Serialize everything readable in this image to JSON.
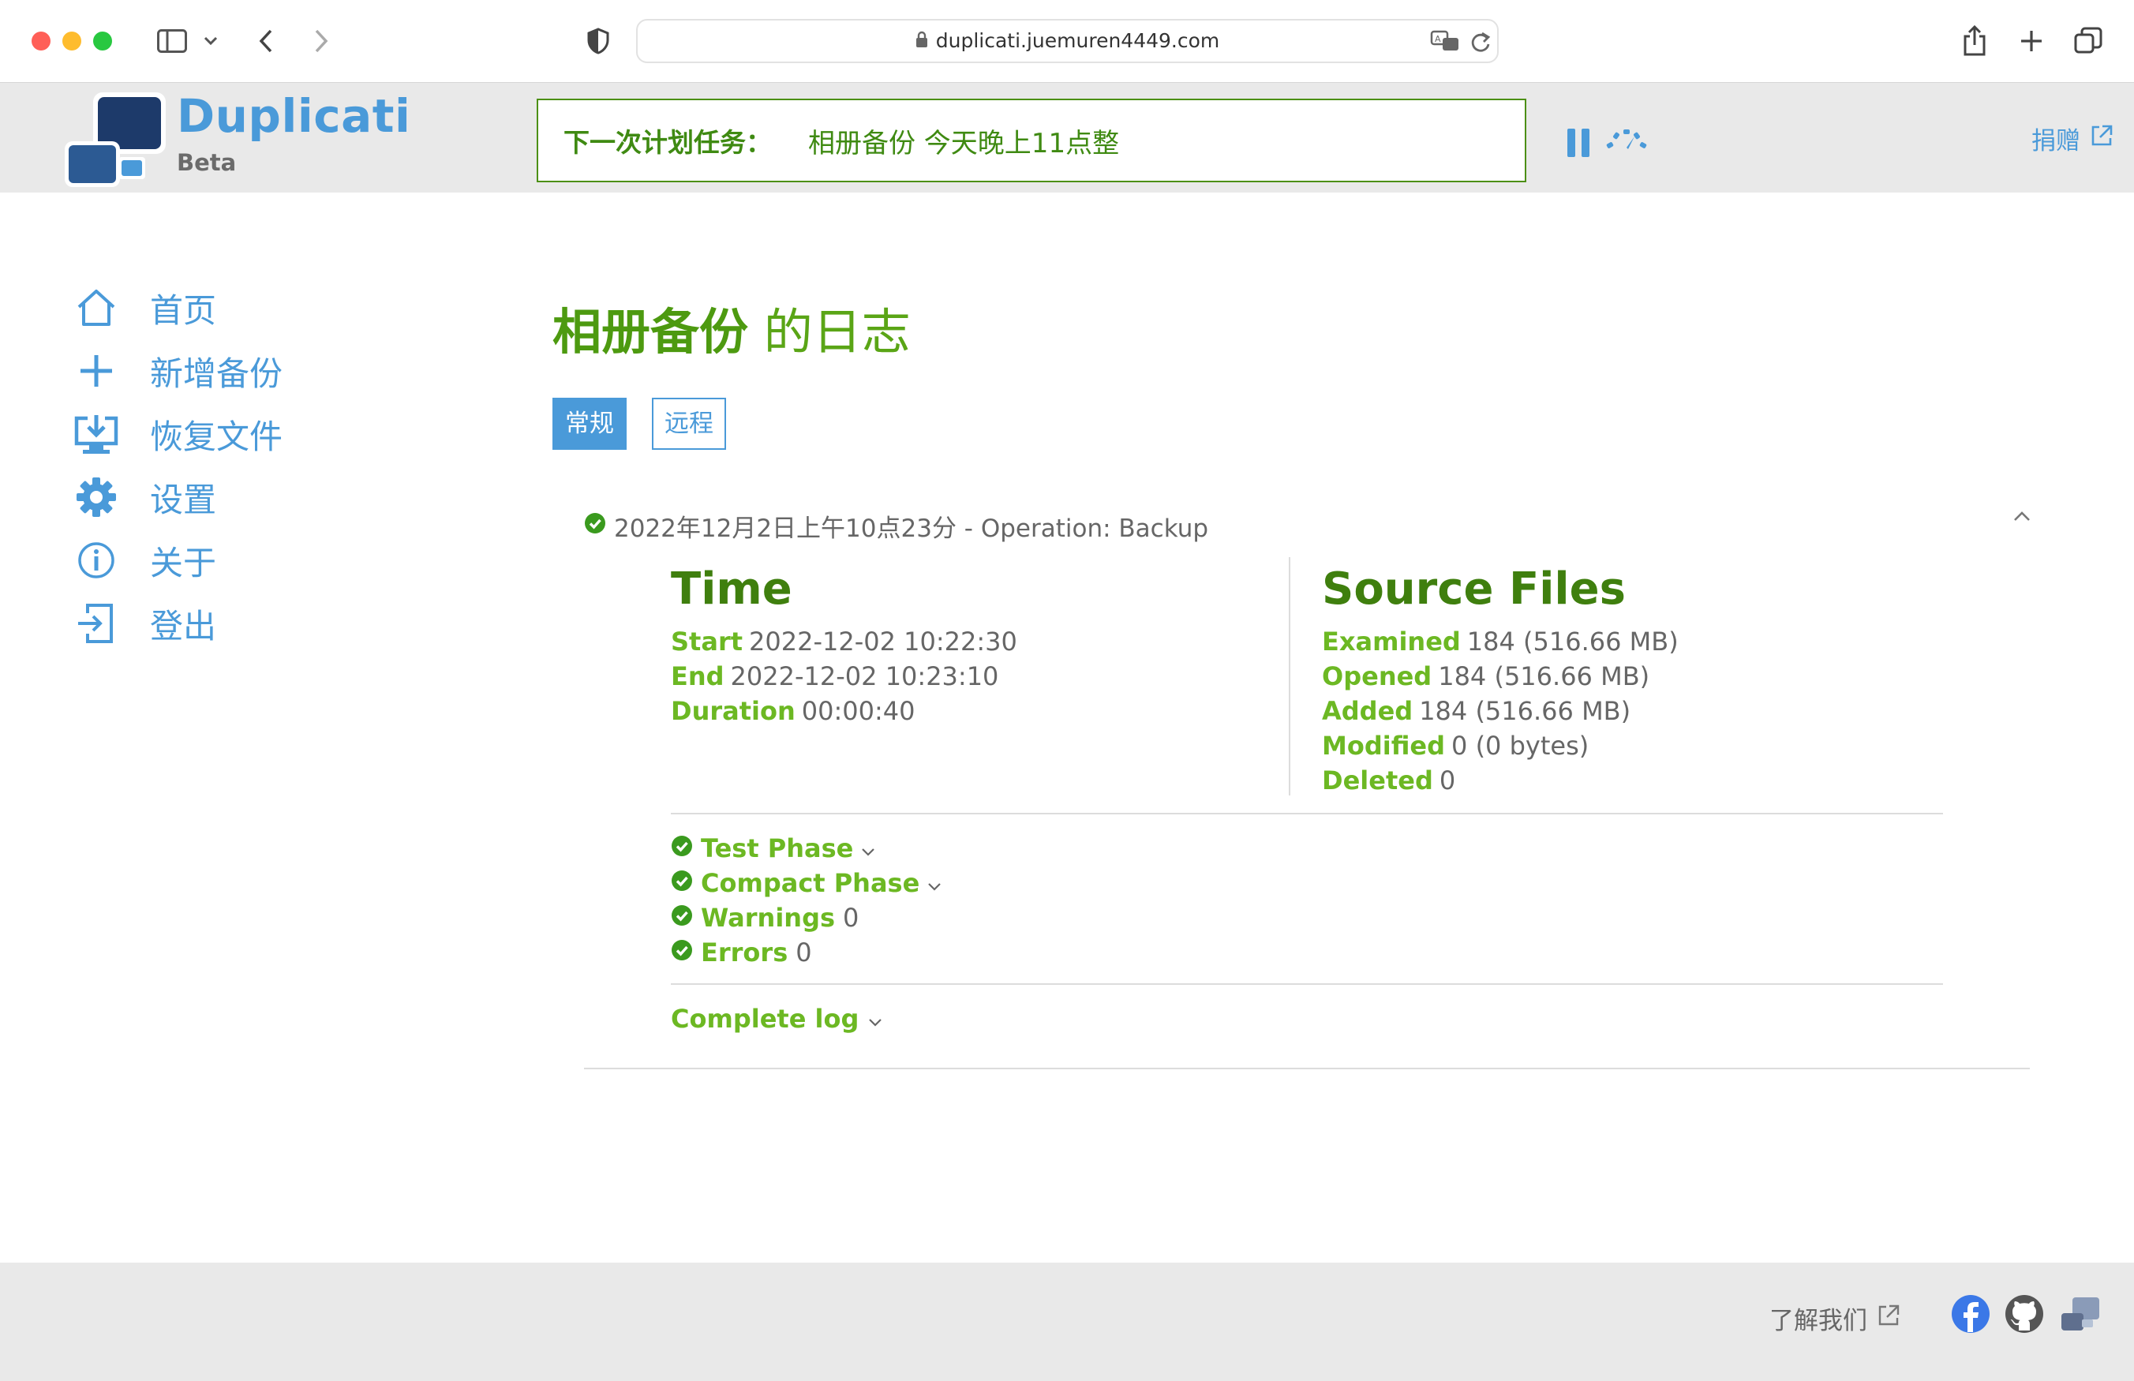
{
  "browser": {
    "url": "duplicati.juemuren4449.com"
  },
  "header": {
    "brand": "Duplicati",
    "brand_sub": "Beta",
    "next_task_label": "下一次计划任务：",
    "next_task_value": "相册备份 今天晚上11点整",
    "donate": "捐赠"
  },
  "sidebar": {
    "items": [
      {
        "label": "首页",
        "icon": "home-icon"
      },
      {
        "label": "新增备份",
        "icon": "plus-icon"
      },
      {
        "label": "恢复文件",
        "icon": "restore-icon"
      },
      {
        "label": "设置",
        "icon": "gear-icon"
      },
      {
        "label": "关于",
        "icon": "info-icon"
      },
      {
        "label": "登出",
        "icon": "logout-icon"
      }
    ]
  },
  "main": {
    "title_strong": "相册备份",
    "title_rest": " 的日志",
    "tabs": [
      {
        "label": "常规",
        "active": true
      },
      {
        "label": "远程",
        "active": false
      }
    ],
    "entry": {
      "header": "2022年12月2日上午10点23分 - Operation: Backup",
      "time": {
        "title": "Time",
        "rows": [
          {
            "k": "Start",
            "v": "2022-12-02 10:22:30"
          },
          {
            "k": "End",
            "v": "2022-12-02 10:23:10"
          },
          {
            "k": "Duration",
            "v": "00:00:40"
          }
        ]
      },
      "source": {
        "title": "Source Files",
        "rows": [
          {
            "k": "Examined",
            "v": "184 (516.66 MB)"
          },
          {
            "k": "Opened",
            "v": "184 (516.66 MB)"
          },
          {
            "k": "Added",
            "v": "184 (516.66 MB)"
          },
          {
            "k": "Modified",
            "v": "0 (0 bytes)"
          },
          {
            "k": "Deleted",
            "v": "0"
          }
        ]
      },
      "phases": [
        {
          "k": "Test Phase",
          "v": ""
        },
        {
          "k": "Compact Phase",
          "v": ""
        },
        {
          "k": "Warnings",
          "v": "0"
        },
        {
          "k": "Errors",
          "v": "0"
        }
      ],
      "complete_log": "Complete log"
    }
  },
  "footer": {
    "learn": "了解我们"
  },
  "colors": {
    "accent_blue": "#4a9ad9",
    "green_dark": "#3f7f0e",
    "green_light": "#6cb823",
    "header_bg": "#e9e9e9"
  }
}
